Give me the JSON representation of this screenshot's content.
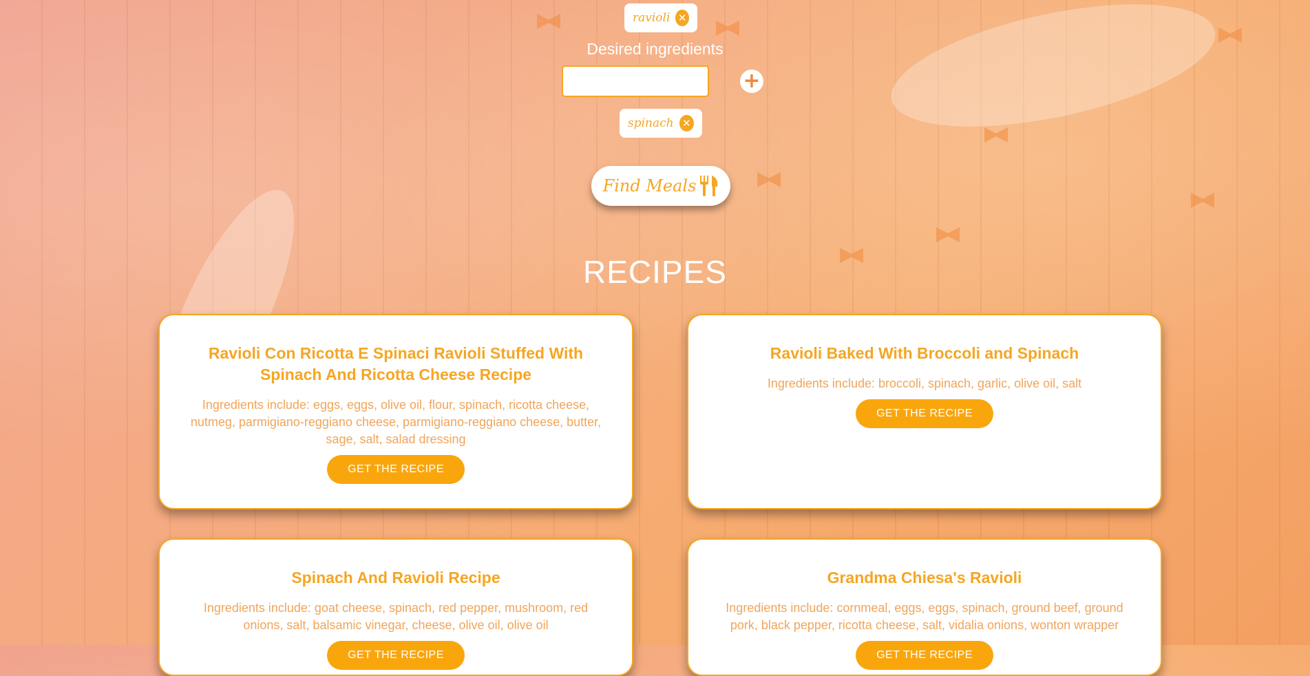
{
  "search": {
    "selected_chip": "ravioli",
    "desired_label": "Desired ingredients",
    "input_value": "",
    "added_chip": "spinach",
    "find_label": "Find Meals"
  },
  "icons": {
    "remove": "close-circle-icon",
    "add": "plus-circle-icon",
    "utensils": "fork-knife-icon"
  },
  "colors": {
    "accent": "#f5a623",
    "button": "#f9a60d"
  },
  "recipes": {
    "heading": "RECIPES",
    "cards": [
      {
        "title": "Ravioli Con Ricotta E Spinaci Ravioli Stuffed With Spinach And Ricotta Cheese Recipe",
        "ingredients": "Ingredients include: eggs, eggs, olive oil, flour, spinach, ricotta cheese, nutmeg, parmigiano-reggiano cheese, parmigiano-reggiano cheese, butter, sage, salt, salad dressing",
        "button": "GET THE RECIPE"
      },
      {
        "title": "Ravioli Baked With Broccoli and Spinach",
        "ingredients": "Ingredients include: broccoli, spinach, garlic, olive oil, salt",
        "button": "GET THE RECIPE"
      },
      {
        "title": "Spinach And Ravioli Recipe",
        "ingredients": "Ingredients include: goat cheese, spinach, red pepper, mushroom, red onions, salt, balsamic vinegar, cheese, olive oil, olive oil",
        "button": "GET THE RECIPE"
      },
      {
        "title": "Grandma Chiesa's Ravioli",
        "ingredients": "Ingredients include: cornmeal, eggs, eggs, spinach, ground beef, ground pork, black pepper, ricotta cheese, salt, vidalia onions, wonton wrapper",
        "button": "GET THE RECIPE"
      }
    ]
  }
}
